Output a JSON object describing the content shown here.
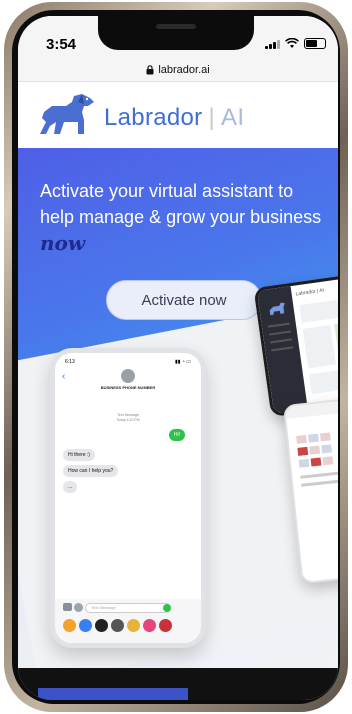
{
  "status_bar": {
    "time": "3:54"
  },
  "browser": {
    "url": "labrador.ai"
  },
  "logo": {
    "name": "Labrador",
    "suffix": "AI"
  },
  "hero": {
    "headline": "Activate your virtual assistant to help manage & grow your business",
    "emphasis": "now",
    "cta_label": "Activate now"
  },
  "mock_phone": {
    "time": "6:13",
    "contact": "BUSINESS PHONE NUMBER",
    "meta_line1": "Text Message",
    "meta_line2": "Today 6:10 PM",
    "outgoing": "Hi!",
    "reply1": "Hi there :)",
    "reply2": "How can I help you?",
    "reply3": "...",
    "input_placeholder": "Text Message"
  },
  "dashboard": {
    "header": "Labrador | AI"
  },
  "colors": {
    "brand_blue": "#3f6fd6",
    "cta_bg": "#e9eefa",
    "hero_start": "#4f5fe6",
    "hero_end": "#3da1ee"
  },
  "icons": [
    "lock-icon",
    "signal-icon",
    "wifi-icon",
    "battery-icon",
    "labrador-dog-logo"
  ]
}
